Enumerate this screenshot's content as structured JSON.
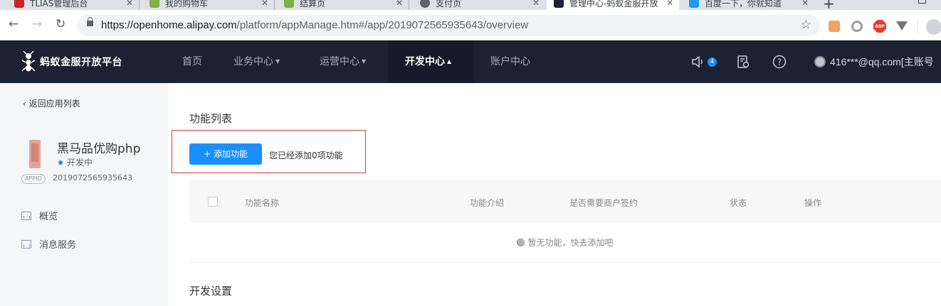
{
  "browser": {
    "tabs": [
      {
        "title": "TLIAS管理后台",
        "favicon": "#c62828"
      },
      {
        "title": "我的购物车",
        "favicon": "#7cb342"
      },
      {
        "title": "结算页",
        "favicon": "#7cb342"
      },
      {
        "title": "支付页",
        "favicon": "#5f6368"
      },
      {
        "title": "管理中心-蚂蚁金服开放",
        "favicon": "#1d2233"
      },
      {
        "title": "百度一下，你就知道",
        "favicon": "#2196f3"
      }
    ],
    "url_host": "https://openhome.alipay.com",
    "url_path": "/platform/appManage.htm#/app/2019072565935643/overview",
    "abp_label": "ABP"
  },
  "header": {
    "logo_text": "蚂蚁金服开放平台",
    "nav": [
      {
        "label": "首页",
        "has_caret": false,
        "active": false
      },
      {
        "label": "业务中心",
        "has_caret": true,
        "active": false
      },
      {
        "label": "运营中心",
        "has_caret": true,
        "active": false
      },
      {
        "label": "开发中心",
        "has_caret": true,
        "active": true
      },
      {
        "label": "账户中心",
        "has_caret": false,
        "active": false
      }
    ],
    "notification_count": "4",
    "account": "416***@qq.com[主账号"
  },
  "sidebar": {
    "back_label": "返回应用列表",
    "app_name": "黑马品优购php",
    "status": "开发中",
    "appid_tag": "APPID",
    "appid": "2019072565935643",
    "menu": [
      {
        "label": "概览",
        "icon": "monitor-icon"
      },
      {
        "label": "消息服务",
        "icon": "chart-icon"
      }
    ]
  },
  "main": {
    "function_list_title": "功能列表",
    "add_button": "+ 添加功能",
    "add_note": "您已经添加0项功能",
    "columns": [
      "功能名称",
      "功能介绍",
      "是否需要商户签约",
      "状态",
      "操作"
    ],
    "empty_text": "暂无功能，快去添加吧",
    "dev_settings_title": "开发设置"
  },
  "colors": {
    "header_bg": "#1d2233",
    "primary": "#1890ff",
    "highlight": "#d9363e",
    "sidebar_bg": "#f5f6f8"
  }
}
